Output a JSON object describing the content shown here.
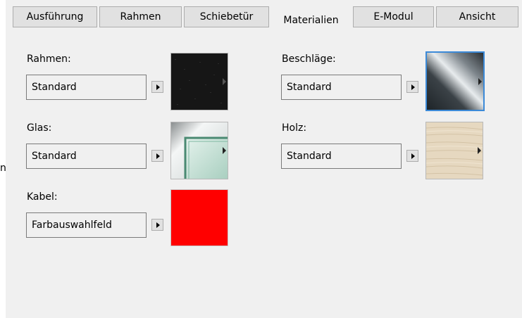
{
  "window": {
    "left_edge_text": "n"
  },
  "tabs": [
    {
      "label": "Ausführung",
      "active": false
    },
    {
      "label": "Rahmen",
      "active": false
    },
    {
      "label": "Schiebetür",
      "active": false
    },
    {
      "label": "Materialien",
      "active": true
    },
    {
      "label": "E-Modul",
      "active": false
    },
    {
      "label": "Ansicht",
      "active": false
    }
  ],
  "materials": {
    "rahmen": {
      "label": "Rahmen:",
      "value": "Standard",
      "swatch": "black-texture",
      "swatch_color": "#1a1a1a"
    },
    "beschlaege": {
      "label": "Beschläge:",
      "value": "Standard",
      "swatch": "chrome-gradient",
      "swatch_color": "#5a6066",
      "selected": true
    },
    "glas": {
      "label": "Glas:",
      "value": "Standard",
      "swatch": "glass-corner",
      "swatch_color": "#cfe6dc"
    },
    "holz": {
      "label": "Holz:",
      "value": "Standard",
      "swatch": "light-wood",
      "swatch_color": "#e6d8c0"
    },
    "kabel": {
      "label": "Kabel:",
      "value": "Farbauswahlfeld",
      "swatch": "solid-color",
      "swatch_color": "#ff0000"
    }
  },
  "colors": {
    "dialog_bg": "#f0f0f0",
    "tab_bg": "#e1e1e1",
    "selection_border": "#3c8ad8"
  }
}
